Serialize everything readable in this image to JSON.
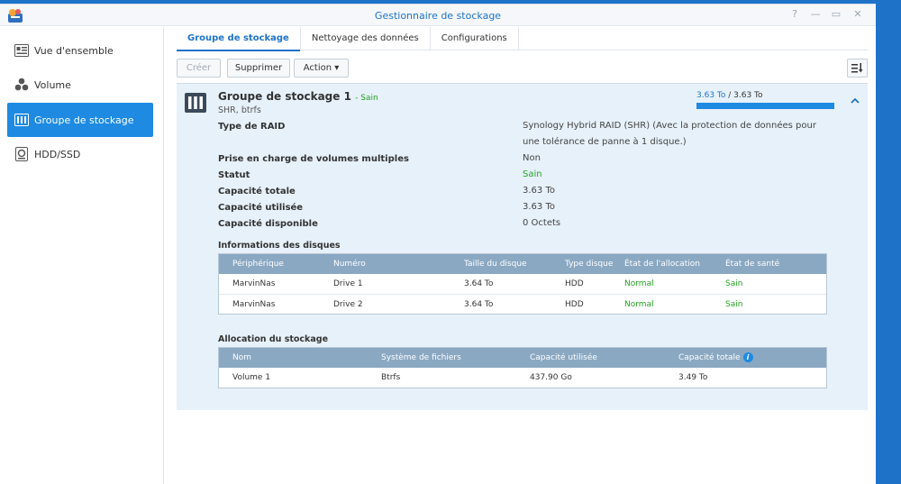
{
  "window": {
    "title": "Gestionnaire de stockage",
    "controls": {
      "help": "?",
      "minimize": "—",
      "maximize": "▭",
      "close": "✕"
    }
  },
  "sidebar": {
    "items": [
      {
        "label": "Vue d'ensemble",
        "icon": "overview-icon",
        "active": false
      },
      {
        "label": "Volume",
        "icon": "volume-icon",
        "active": false
      },
      {
        "label": "Groupe de stockage",
        "icon": "storage-pool-icon",
        "active": true
      },
      {
        "label": "HDD/SSD",
        "icon": "hdd-icon",
        "active": false
      }
    ]
  },
  "tabs": [
    {
      "label": "Groupe de stockage",
      "active": true
    },
    {
      "label": "Nettoyage des données",
      "active": false
    },
    {
      "label": "Configurations",
      "active": false
    }
  ],
  "toolbar": {
    "create_label": "Créer",
    "delete_label": "Supprimer",
    "action_label": "Action ▾"
  },
  "pool": {
    "title": "Groupe de stockage 1",
    "status": "- Sain",
    "subtitle": "SHR, btrfs",
    "capacity_used": "3.63 To",
    "capacity_sep": " / ",
    "capacity_total": "3.63 To",
    "usage_fraction": 1.0,
    "details": [
      {
        "label": "Type de RAID",
        "value": "Synology Hybrid RAID (SHR) (Avec la protection de données pour une tolérance de panne à 1 disque.)"
      },
      {
        "label": "Prise en charge de volumes multiples",
        "value": "Non"
      },
      {
        "label": "Statut",
        "value": "Sain"
      },
      {
        "label": "Capacité totale",
        "value": "3.63 To"
      },
      {
        "label": "Capacité utilisée",
        "value": "3.63 To"
      },
      {
        "label": "Capacité disponible",
        "value": "0 Octets"
      }
    ]
  },
  "disks": {
    "title": "Informations des disques",
    "headers": [
      "Périphérique",
      "Numéro",
      "Taille du disque",
      "Type disque",
      "État de l'allocation",
      "État de santé"
    ],
    "rows": [
      [
        "MarvinNas",
        "Drive 1",
        "3.64 To",
        "HDD",
        "Normal",
        "Sain"
      ],
      [
        "MarvinNas",
        "Drive 2",
        "3.64 To",
        "HDD",
        "Normal",
        "Sain"
      ]
    ]
  },
  "allocation": {
    "title": "Allocation du stockage",
    "headers": [
      "Nom",
      "Système de fichiers",
      "Capacité utilisée",
      "Capacité totale"
    ],
    "rows": [
      [
        "Volume 1",
        "Btrfs",
        "437.90 Go",
        "3.49 To"
      ]
    ]
  },
  "colors": {
    "accent": "#1e73c9",
    "active_bg": "#1e8ae2",
    "healthy": "#22a322",
    "panel_bg": "#e7f1fa",
    "table_header": "#8aa8c2"
  }
}
